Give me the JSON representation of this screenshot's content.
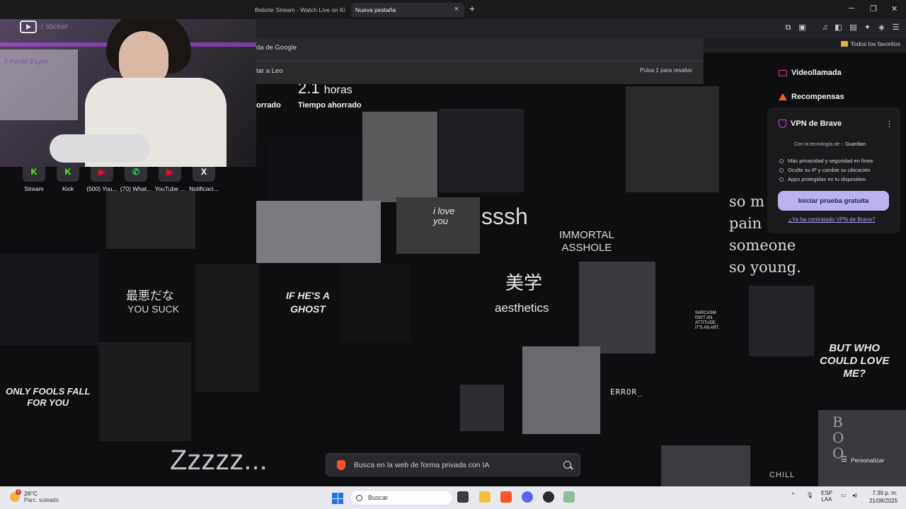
{
  "tabs": [
    {
      "label": "Bebote Stream - Watch Live on Kick"
    },
    {
      "label": "Nueva pestaña",
      "close": "×"
    }
  ],
  "new_tab_symbol": "+",
  "window_controls": {
    "minimize": "─",
    "maximize": "❐",
    "close": "✕"
  },
  "toolbar_icons": [
    "puzzle-icon",
    "screenshot-icon",
    "music-icon",
    "sidebar-icon",
    "wallet-icon",
    "leo-icon",
    "shield-icon",
    "menu-icon"
  ],
  "bookmarks": {
    "all_favorites": "Todos los favoritos"
  },
  "omnibox_dropdown": {
    "row1": "da de Google",
    "row2": "tar a Leo",
    "hint": "Pulsa 1 para resaltar"
  },
  "webcam": {
    "handle": "/ sticker",
    "board_text": "3 Fondo 3 Lynn"
  },
  "shortcuts": [
    {
      "label": "Stream",
      "icon": "K",
      "color": "#53fc18"
    },
    {
      "label": "Kick",
      "icon": "K",
      "color": "#53fc18"
    },
    {
      "label": "(500) You...",
      "icon": "▶",
      "color": "#ff0033"
    },
    {
      "label": "(70) What...",
      "icon": "✆",
      "color": "#25d366"
    },
    {
      "label": "YouTube ...",
      "icon": "▶",
      "color": "#ff0033"
    },
    {
      "label": "Notificaci...",
      "icon": "X",
      "color": "#ffffff"
    }
  ],
  "stats": {
    "hours_value": "2.1",
    "hours_unit": "horas",
    "label_left": "orrado",
    "label_right": "Tiempo ahorrado"
  },
  "wallpaper_texts": {
    "ssh": "sssh",
    "immortal": "IMMORTAL\nASSHOLE",
    "jp1": "最悪だな",
    "you_suck": "YOU SUCK",
    "if_ghost": "IF HE'S A\nGHOST",
    "bigaku": "美学",
    "aesthetics": "aesthetics",
    "so_many": "so m\npain\nsomeone\nso young.",
    "only_fools": "ONLY FOOLS FALL\nFOR YOU",
    "but_who": "BUT WHO\nCOULD LOVE\nME?",
    "error": "ERROR_",
    "sarcasm": "SARCASM\nISN'T AN\nATTITUDE,\nIT'S AN ART.",
    "zzz": "Zzzzz...",
    "chill": "CHILL",
    "boo": "B\nO\nO",
    "i_love_you": "i love\nyou"
  },
  "brave_panel": {
    "videocall": "Videollamada",
    "rewards": "Recompensas",
    "vpn_title": "VPN de Brave",
    "powered_by": "Con la tecnología de",
    "powered_brand": "Guardian",
    "features": [
      "Más privacidad y seguridad en línea",
      "Oculte su IP y cambie su ubicación",
      "Apps protegidas en tu dispositivo"
    ],
    "trial_button": "Iniciar prueba gratuita",
    "already_link": "¿Ya ha contratado VPN de Brave?",
    "accent": "#b9b2ef"
  },
  "search": {
    "placeholder": "Busca en la web de forma privada con IA"
  },
  "personalize": "Personalizar",
  "taskbar": {
    "temperature": "26°C",
    "condition": "Parc. soleado",
    "weather_badge": "3",
    "search_label": "Buscar",
    "lang_top": "ESP",
    "lang_bottom": "LAA",
    "time": "7:39 p. m.",
    "date": "21/08/2025"
  }
}
